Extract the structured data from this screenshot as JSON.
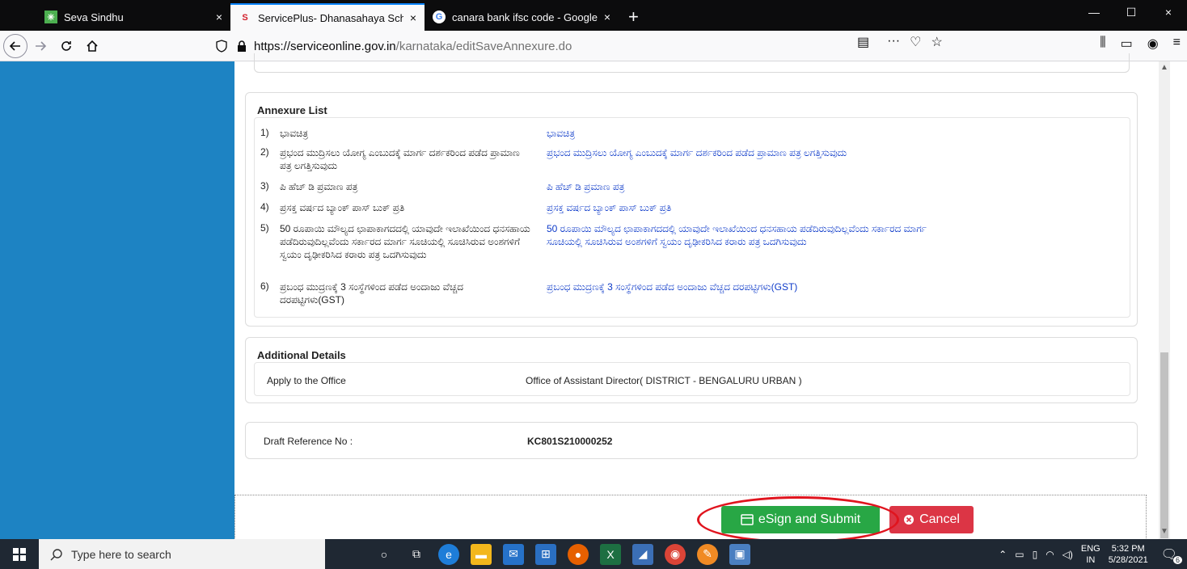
{
  "tabs": [
    {
      "title": "Seva Sindhu",
      "close": "×"
    },
    {
      "title": "ServicePlus- Dhanasahaya Sche",
      "close": "×"
    },
    {
      "title": "canara bank ifsc code - Google",
      "close": "×"
    }
  ],
  "new_tab": "+",
  "window_controls": {
    "minimize": "—",
    "maximize": "☐",
    "close": "×"
  },
  "url": {
    "host": "https://serviceonline.gov.in",
    "path": "/karnataka/editSaveAnnexure.do"
  },
  "annexure": {
    "title": "Annexure List",
    "items": [
      {
        "num": "1)",
        "name": "ಭಾವಚಿತ್ರ",
        "link": "ಭಾವಚಿತ್ರ"
      },
      {
        "num": "2)",
        "name": "ಪ್ರಭಂದ ಮುದ್ರಿಸಲು ಯೋಗ್ಯ ಎಂಬುದಕ್ಕೆ ಮಾರ್ಗ ದರ್ಶಕರಿಂದ ಪಡೆದ ಪ್ರಾಮಾಣ ಪತ್ರ ಲಗತ್ತಿಸುವುದು",
        "link": "ಪ್ರಭಂದ ಮುದ್ರಿಸಲು ಯೋಗ್ಯ ಎಂಬುದಕ್ಕೆ ಮಾರ್ಗ ದರ್ಶಕರಿಂದ ಪಡೆದ ಪ್ರಾಮಾಣ ಪತ್ರ ಲಗತ್ತಿಸುವುದು"
      },
      {
        "num": "3)",
        "name": "ಪಿ ಹೆಚ್ ಡಿ ಪ್ರಮಾಣ ಪತ್ರ",
        "link": "ಪಿ ಹೆಚ್ ಡಿ ಪ್ರಮಾಣ ಪತ್ರ"
      },
      {
        "num": "4)",
        "name": "ಪ್ರಸಕ್ತ ವರ್ಷದ ಬ್ಯಾಂಕ್ ಪಾಸ್ ಬುಕ್ ಪ್ರತಿ",
        "link": "ಪ್ರಸಕ್ತ ವರ್ಷದ ಬ್ಯಾಂಕ್ ಪಾಸ್ ಬುಕ್ ಪ್ರತಿ"
      },
      {
        "num": "5)",
        "name": "50 ರೂಪಾಯಿ ಮೌಲ್ಯದ ಛಾಪಾಕಾಗದದಲ್ಲಿ ಯಾವುದೇ ಇಲಾಖೆಯಿಂದ ಧನಸಹಾಯ ಪಡೆದಿರುವುದಿಲ್ಲವೆಂದು ಸರ್ಕಾರದ ಮಾರ್ಗ ಸೂಚಿಯಲ್ಲಿ ಸೂಚಿಸಿರುವ ಅಂಶಗಳಿಗೆ ಸ್ವಯಂ ದೃಢೀಕರಿಸಿದ ಕರಾರು ಪತ್ರ ಒದಗಿಸುವುದು",
        "link": "50 ರೂಪಾಯಿ ಮೌಲ್ಯದ ಛಾಪಾಕಾಗದದಲ್ಲಿ ಯಾವುದೇ ಇಲಾಖೆಯಿಂದ ಧನಸಹಾಯ ಪಡೆದಿರುವುದಿಲ್ಲವೆಂದು ಸರ್ಕಾರದ ಮಾರ್ಗ ಸೂಚಿಯಲ್ಲಿ ಸೂಚಿಸಿರುವ ಅಂಶಗಳಿಗೆ ಸ್ವಯಂ ದೃಢೀಕರಿಸಿದ ಕರಾರು ಪತ್ರ ಒದಗಿಸುವುದು"
      },
      {
        "num": "6)",
        "name": "ಪ್ರಬಂಧ ಮುದ್ರಣಕ್ಕೆ 3 ಸಂಸ್ಥೆಗಳಿಂದ ಪಡೆದ ಅಂದಾಜು ವೆಚ್ಚದ ದರಪಟ್ಟಿಗಳು(GST)",
        "link": "ಪ್ರಬಂಧ ಮುದ್ರಣಕ್ಕೆ 3 ಸಂಸ್ಥೆಗಳಿಂದ ಪಡೆದ ಅಂದಾಜು ವೆಚ್ಚದ ದರಪಟ್ಟಿಗಳು(GST)"
      }
    ]
  },
  "additional": {
    "title": "Additional Details",
    "label": "Apply to the Office",
    "value": "Office of Assistant Director( DISTRICT - BENGALURU URBAN )"
  },
  "draft": {
    "label": "Draft Reference No :",
    "value": "KC801S210000252"
  },
  "buttons": {
    "esign": "eSign and Submit",
    "cancel": "Cancel"
  },
  "taskbar": {
    "search_placeholder": "Type here to search",
    "lang_top": "ENG",
    "lang_bottom": "IN",
    "time": "5:32 PM",
    "date": "5/28/2021",
    "notification_count": "6"
  }
}
